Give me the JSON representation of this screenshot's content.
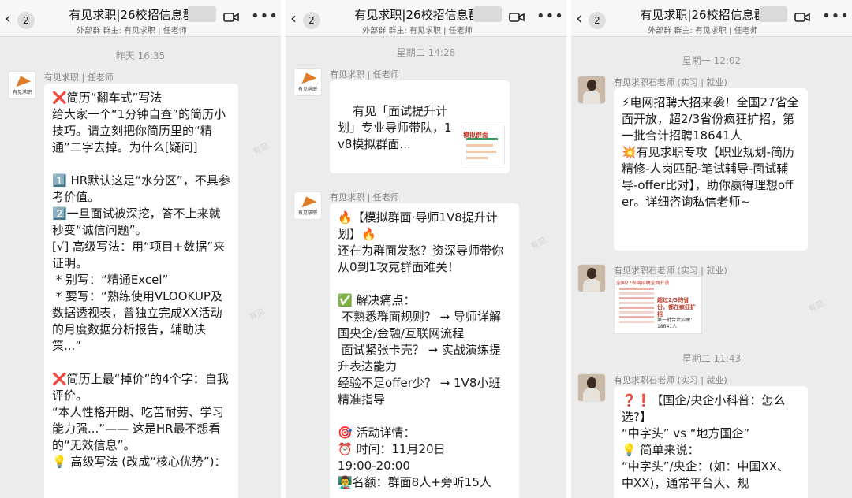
{
  "nav": {
    "back_glyph": "‹",
    "badge": "2",
    "title": "有见求职|26校招信息群",
    "subtitle_tag": "外部群",
    "subtitle_owner": "群主: 有见求职 | 任老师",
    "more": "•••"
  },
  "panel1": {
    "time": "昨天 16:35",
    "avatar_text": "有见求职",
    "sender": "有见求职 | 任老师",
    "message": "❌简历“翻车式”写法\n给大家一个“1分钟自查”的简历小技巧。请立刻把你简历里的“精通”二字去掉。为什么[疑问]\n\n1️⃣ HR默认这是“水分区”，不具参考价值。\n2️⃣一旦面试被深挖，答不上来就秒变“诚信问题”。\n[√] 高级写法：用“项目+数据”来证明。\n * 别写：“精通Excel”\n * 要写：“熟练使用VLOOKUP及数据透视表，曾独立完成XX活动的月度数据分析报告，辅助决策...”\n\n❌简历上最“掉价”的4个字：自我评价。\n“本人性格开朗、吃苦耐劳、学习能力强...”—— 这是HR最不想看的“无效信息”。\n💡 高级写法 (改成“核心优势”)："
  },
  "panel2": {
    "time": "星期二 14:28",
    "avatar_text": "有见求职",
    "sender": "有见求职 | 任老师",
    "card_text": "有见「面试提升计划」专业导师带队，1v8模拟群面...",
    "card_thumb_title": "模拟群面",
    "sender2": "有见求职 | 任老师",
    "message": "🔥【模拟群面·导师1V8提升计划】🔥\n还在为群面发愁？资深导师带你从0到1攻克群面难关！\n\n✅ 解决痛点：\n 不熟悉群面规则？ → 导师详解国央企/金融/互联网流程\n 面试紧张卡壳？ → 实战演练提升表达能力\n经验不足offer少？ → 1V8小班精准指导\n\n🎯 活动详情：\n⏰ 时间：11月20日\n19:00-20:00\n👨‍🏫名额：群面8人+旁听15人"
  },
  "panel3": {
    "time1": "星期一 12:02",
    "sender": "有见求职石老师 (实习 | 就业)",
    "message1": "⚡电网招聘大招来袭！全国27省全面开放，超2/3省份疯狂扩招，第一批合计招聘18641人\n💥有见求职专攻【职业规划-简历精修-人岗匹配-笔试辅导-面试辅导-offer比对】，助你赢得理想offer。详细咨询私信老师~",
    "sender2": "有见求职石老师 (实习 | 就业)",
    "image_caption1": "全国27省网招聘全面开放",
    "image_caption2": "超过2/3的省份，都在疯狂扩招",
    "image_caption3": "第一批合计招聘：18641人",
    "time2": "星期二 11:43",
    "sender3": "有见求职石老师 (实习 | 就业)",
    "message2": "❓❗【国企/央企小科普：怎么选?】\n“中字头” vs “地方国企”\n💡 简单来说：\n“中字头”/央企：(如：中国XX、中XX)，通常平台大、规"
  },
  "colors": {
    "nav_bg": "#f7f7f7",
    "chat_bg": "#ececec",
    "bubble": "#ffffff",
    "accent": "#e0372e"
  }
}
